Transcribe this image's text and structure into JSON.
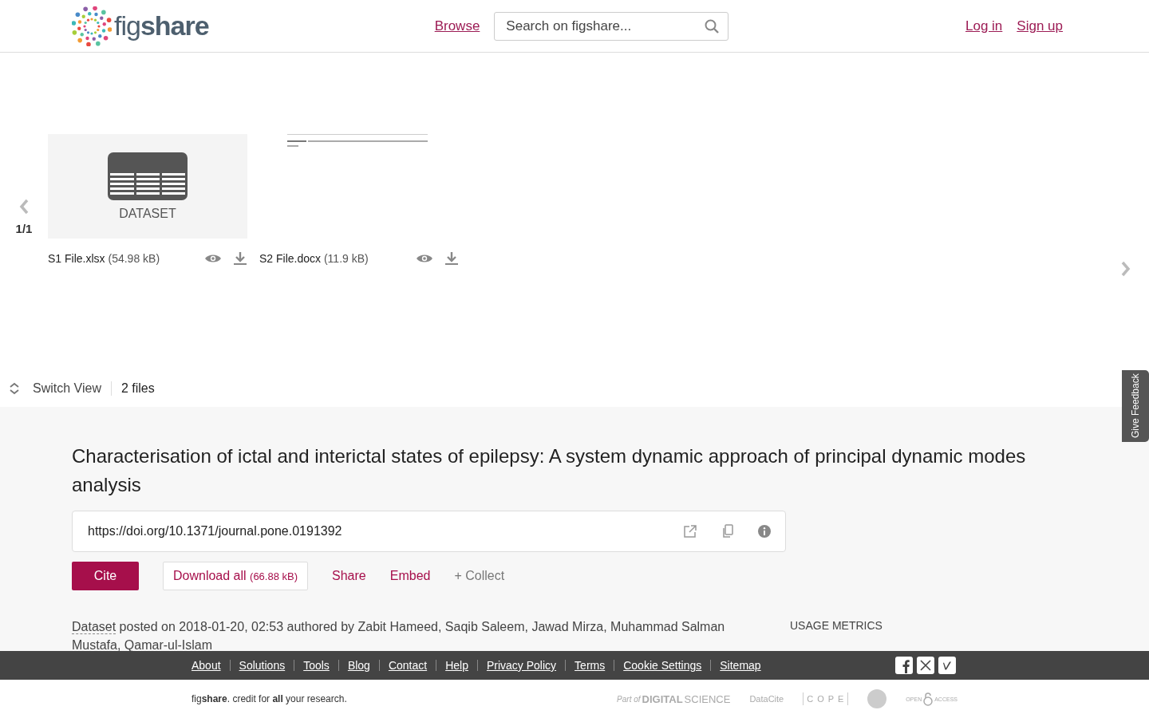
{
  "header": {
    "logo": "fig**share**",
    "nav": [
      {
        "label": "Browse"
      }
    ],
    "search": {
      "placeholder": "Search on figshare..."
    },
    "account_links": [
      {
        "label": "Log in"
      },
      {
        "label": "Sign up"
      }
    ]
  },
  "carousel": {
    "page": "1/1",
    "files": [
      {
        "kind": "dataset",
        "preview_label": "DATASET",
        "name": "S1 File.xlsx",
        "size": "(54.98 kB)"
      },
      {
        "kind": "document",
        "name": "S2 File.docx",
        "size": "(11.9 kB)"
      }
    ]
  },
  "feedback_tab": "Give Feedback",
  "view_bar": {
    "switch_label": "Switch View",
    "file_count": "2 files"
  },
  "item": {
    "title": "Characterisation of ictal and interictal states of epilepsy: A system dynamic approach of principal dynamic modes analysis",
    "doi": "https://doi.org/10.1371/journal.pone.0191392",
    "actions": [
      {
        "kind": "primary",
        "label": "Cite"
      },
      {
        "kind": "outline",
        "label": "Download all",
        "extra": "(66.88 kB)"
      },
      {
        "kind": "link",
        "label": "Share"
      },
      {
        "kind": "link",
        "label": "Embed"
      },
      {
        "kind": "muted",
        "label": "+ Collect"
      }
    ],
    "type": "Dataset",
    "byline": "posted on 2018-01-20, 02:53 authored by Zabit Hameed, Saqib Saleem, Jawad Mirza, Muhammad Salman Mustafa, Qamar-ul-Islam",
    "usage_heading": "USAGE METRICS"
  },
  "footer": {
    "links": [
      "About",
      "Solutions",
      "Tools",
      "Blog",
      "Contact",
      "Help",
      "Privacy Policy",
      "Terms",
      "Cookie Settings",
      "Sitemap"
    ],
    "tagline": "fig**share**. credit for **all** your research.",
    "partners": [
      {
        "kind": "ds",
        "pre": "Part of",
        "label": "DIGITAL",
        "post": "SCIENCE"
      },
      {
        "kind": "datacite",
        "label": "DataCite"
      },
      {
        "kind": "cope",
        "label": "C O P E"
      },
      {
        "kind": "seal"
      },
      {
        "kind": "oa",
        "pre": "OPEN",
        "post": "ACCESS"
      }
    ]
  }
}
